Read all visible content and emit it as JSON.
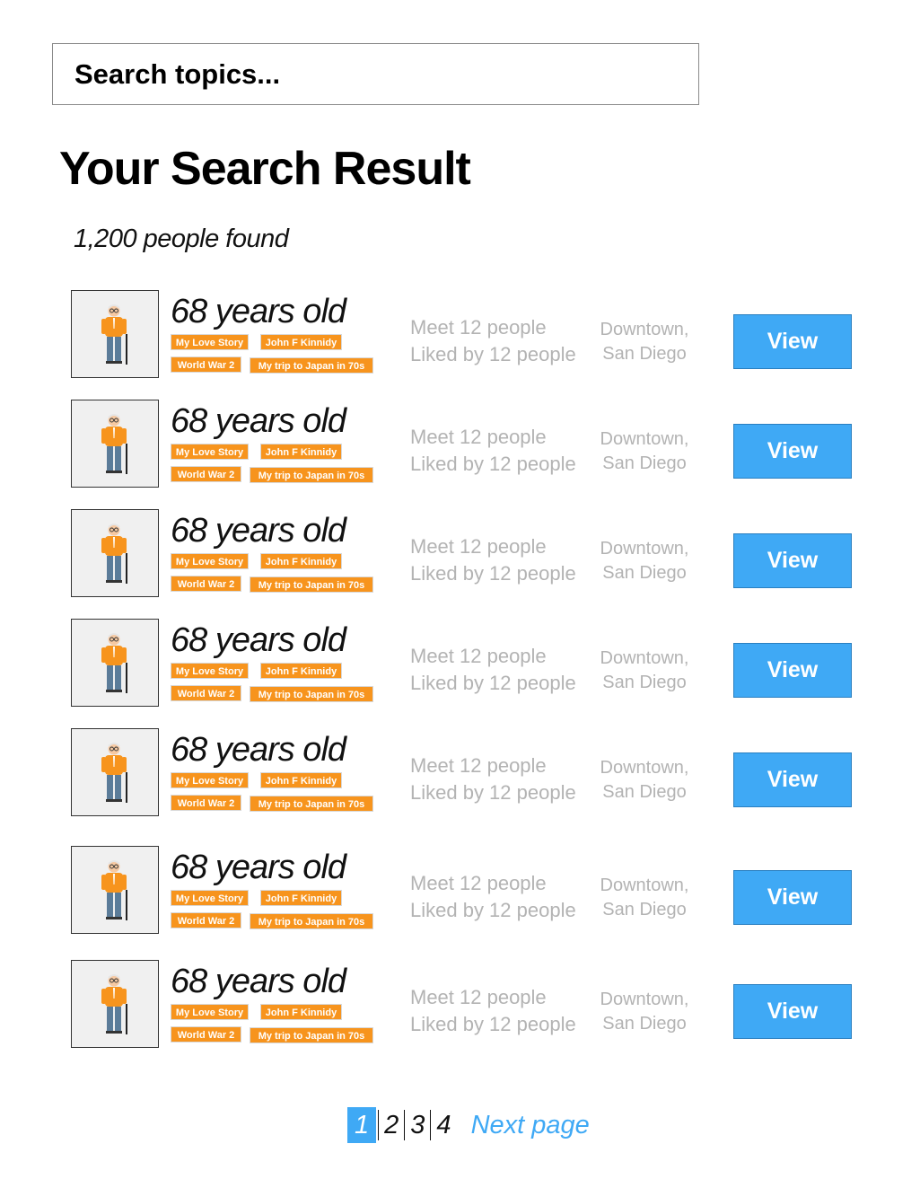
{
  "search": {
    "placeholder": "Search topics..."
  },
  "page": {
    "title": "Your Search Result",
    "results_count": "1,200 people found"
  },
  "results": [
    {
      "age": "68 years old",
      "tags": [
        "My Love Story",
        "John F Kinnidy",
        "World War 2",
        "My trip to Japan in 70s"
      ],
      "meet": "Meet 12 people",
      "liked": "Liked by 12 people",
      "location_line1": "Downtown,",
      "location_line2": "San Diego",
      "view_label": "View"
    },
    {
      "age": "68 years old",
      "tags": [
        "My Love Story",
        "John F Kinnidy",
        "World War 2",
        "My trip to Japan in 70s"
      ],
      "meet": "Meet 12 people",
      "liked": "Liked by 12 people",
      "location_line1": "Downtown,",
      "location_line2": "San Diego",
      "view_label": "View"
    },
    {
      "age": "68 years old",
      "tags": [
        "My Love Story",
        "John F Kinnidy",
        "World War 2",
        "My trip to Japan in 70s"
      ],
      "meet": "Meet 12 people",
      "liked": "Liked by 12 people",
      "location_line1": "Downtown,",
      "location_line2": "San Diego",
      "view_label": "View"
    },
    {
      "age": "68 years old",
      "tags": [
        "My Love Story",
        "John F Kinnidy",
        "World War 2",
        "My trip to Japan in 70s"
      ],
      "meet": "Meet 12 people",
      "liked": "Liked by 12 people",
      "location_line1": "Downtown,",
      "location_line2": "San Diego",
      "view_label": "View"
    },
    {
      "age": "68 years old",
      "tags": [
        "My Love Story",
        "John F Kinnidy",
        "World War 2",
        "My trip to Japan in 70s"
      ],
      "meet": "Meet 12 people",
      "liked": "Liked by 12 people",
      "location_line1": "Downtown,",
      "location_line2": "San Diego",
      "view_label": "View"
    },
    {
      "age": "68 years old",
      "tags": [
        "My Love Story",
        "John F Kinnidy",
        "World War 2",
        "My trip to Japan in 70s"
      ],
      "meet": "Meet 12 people",
      "liked": "Liked by 12 people",
      "location_line1": "Downtown,",
      "location_line2": "San Diego",
      "view_label": "View"
    },
    {
      "age": "68 years old",
      "tags": [
        "My Love Story",
        "John F Kinnidy",
        "World War 2",
        "My trip to Japan in 70s"
      ],
      "meet": "Meet 12 people",
      "liked": "Liked by 12 people",
      "location_line1": "Downtown,",
      "location_line2": "San Diego",
      "view_label": "View"
    }
  ],
  "pagination": {
    "pages": [
      "1",
      "2",
      "3",
      "4"
    ],
    "current": "1",
    "next_label": "Next page"
  },
  "colors": {
    "accent_blue": "#3fa9f5",
    "tag_orange": "#f7941d",
    "muted_text": "#b3b3b3"
  },
  "icons": {
    "avatar": "elderly-man-icon"
  }
}
